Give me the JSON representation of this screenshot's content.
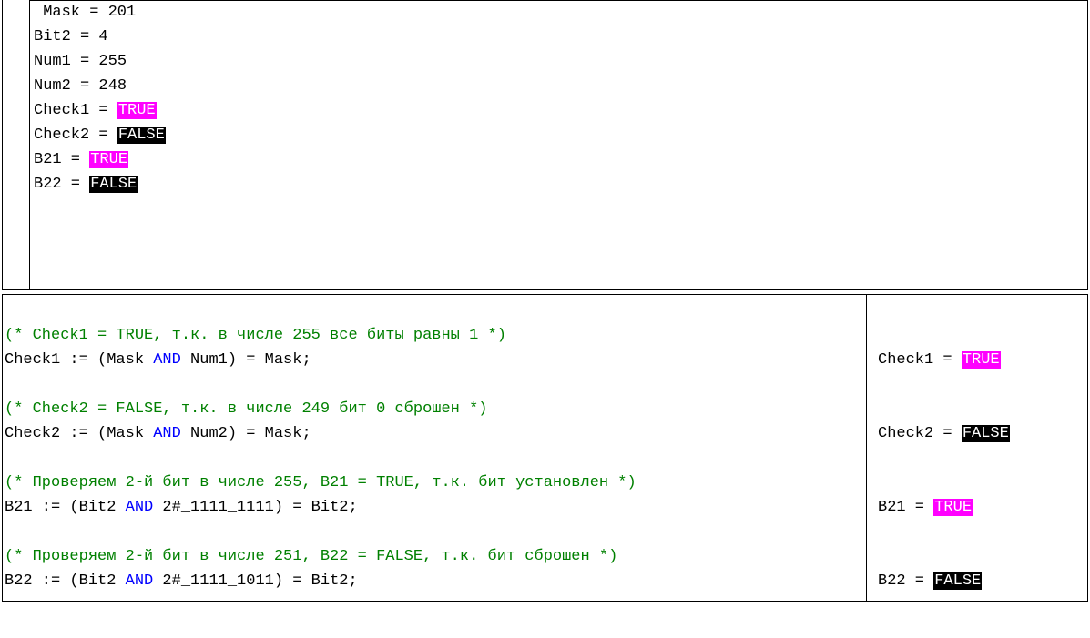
{
  "vars": {
    "mask": {
      "name": "Mask",
      "eq": " = ",
      "val": "201"
    },
    "bit2": {
      "name": "Bit2",
      "eq": " = ",
      "val": "4"
    },
    "num1": {
      "name": "Num1",
      "eq": " = ",
      "val": "255"
    },
    "num2": {
      "name": "Num2",
      "eq": " = ",
      "val": "248"
    },
    "check1": {
      "name": "Check1",
      "eq": " = ",
      "val": "TRUE",
      "bool": true
    },
    "check2": {
      "name": "Check2",
      "eq": " = ",
      "val": "FALSE",
      "bool": false
    },
    "b21": {
      "name": "B21",
      "eq": " = ",
      "val": "TRUE",
      "bool": true
    },
    "b22": {
      "name": "B22",
      "eq": " = ",
      "val": "FALSE",
      "bool": false
    }
  },
  "code": {
    "c1_comment": "(* Check1 = TRUE, т.к. в числе 255 все биты равны 1 *)",
    "c1_a": "Check1 := (Mask ",
    "c1_kw": "AND",
    "c1_b": " Num1) = Mask;",
    "c2_comment": "(* Check2 = FALSE, т.к. в числе 249 бит 0 сброшен *)",
    "c2_a": "Check2 := (Mask ",
    "c2_kw": "AND",
    "c2_b": " Num2) = Mask;",
    "c3_comment": "(* Проверяем 2-й бит в числе 255, B21 = TRUE, т.к. бит установлен *)",
    "c3_a": "B21 := (Bit2 ",
    "c3_kw": "AND",
    "c3_b": " 2#_1111_1111) = Bit2;",
    "c4_comment": "(* Проверяем 2-й бит в числе 251, B22 = FALSE, т.к. бит сброшен *)",
    "c4_a": "B22 := (Bit2 ",
    "c4_kw": "AND",
    "c4_b": " 2#_1111_1011) = Bit2;"
  },
  "results": {
    "r1": {
      "name": "Check1",
      "eq": " = ",
      "val": "TRUE",
      "bool": true
    },
    "r2": {
      "name": "Check2",
      "eq": " = ",
      "val": "FALSE",
      "bool": false
    },
    "r3": {
      "name": "B21",
      "eq": " = ",
      "val": "TRUE",
      "bool": true
    },
    "r4": {
      "name": "B22",
      "eq": " = ",
      "val": "FALSE",
      "bool": false
    }
  }
}
